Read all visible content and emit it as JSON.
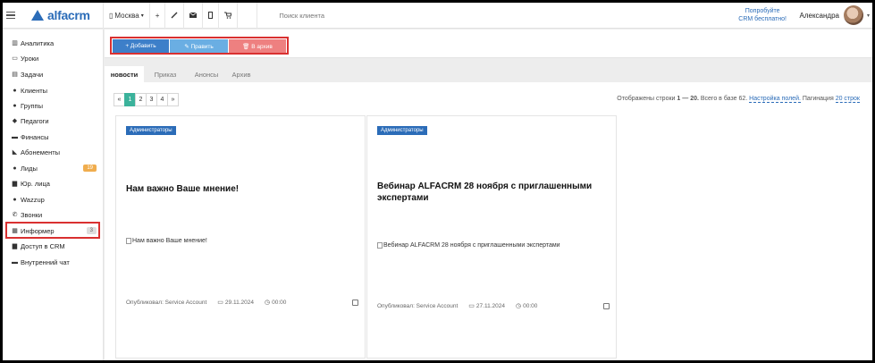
{
  "topbar": {
    "city": "Москва",
    "search_placeholder": "Поиск клиента",
    "promo_line1": "Попробуйте",
    "promo_line2": "CRM бесплатно!",
    "user_name": "Александра"
  },
  "logo": {
    "text": "alfacrm"
  },
  "sidebar": {
    "items": [
      {
        "label": "Аналитика",
        "icon": "chart-icon"
      },
      {
        "label": "Уроки",
        "icon": "calendar-icon"
      },
      {
        "label": "Задачи",
        "icon": "tasks-icon"
      },
      {
        "label": "Клиенты",
        "icon": "user-icon"
      },
      {
        "label": "Группы",
        "icon": "users-icon"
      },
      {
        "label": "Педагоги",
        "icon": "graduation-cap-icon"
      },
      {
        "label": "Финансы",
        "icon": "money-icon"
      },
      {
        "label": "Абонементы",
        "icon": "tag-icon"
      },
      {
        "label": "Лиды",
        "icon": "user-plus-icon",
        "badge": "19"
      },
      {
        "label": "Юр. лица",
        "icon": "briefcase-icon"
      },
      {
        "label": "Wazzup",
        "icon": "whatsapp-icon"
      },
      {
        "label": "Звонки",
        "icon": "phone-icon"
      },
      {
        "label": "Информер",
        "icon": "newspaper-icon",
        "badge": "3"
      },
      {
        "label": "Доступ в CRM",
        "icon": "lock-icon"
      },
      {
        "label": "Внутренний чат",
        "icon": "chat-icon"
      }
    ]
  },
  "toolbar": {
    "add_label": "+ Добавить",
    "edit_label": "✎ Править",
    "archive_label": "🗑 В архив"
  },
  "tabs": [
    "новости",
    "Приказ",
    "Анонсы",
    "Архив"
  ],
  "pager": {
    "prev": "«",
    "pages": [
      "1",
      "2",
      "3",
      "4"
    ],
    "next": "»",
    "info_prefix": "Отображены строки",
    "info_range": "1 — 20.",
    "info_total": "Всего в базе 62.",
    "settings_link": "Настройка полей.",
    "pagination_label": "Пагинация",
    "pagination_value": "20 строк"
  },
  "cards": [
    {
      "badge": "Администраторы",
      "title": "Нам важно Ваше мнение!",
      "image_alt": "Нам важно Ваше мнение!",
      "published_by": "Опубликовал: Service Account",
      "date": "29.11.2024",
      "time": "00:00"
    },
    {
      "badge": "Администраторы",
      "title": "Вебинар ALFACRM 28 ноября с приглашенными экспертами",
      "image_alt": "Вебинар ALFACRM 28 ноября с приглашенными экспертами",
      "published_by": "Опубликовал: Service Account",
      "date": "27.11.2024",
      "time": "00:00"
    }
  ],
  "colors": {
    "brand": "#2b6cb8",
    "add_button": "#3d7fc9",
    "edit_button": "#6aaee3",
    "archive_button": "#ee8080",
    "pager_active": "#3bb29b",
    "highlight": "#d93030"
  }
}
